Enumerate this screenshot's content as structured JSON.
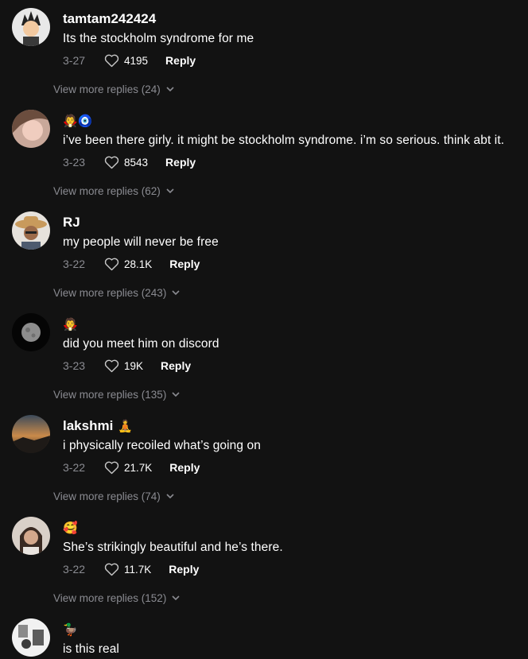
{
  "comments": [
    {
      "author": "tamtam242424",
      "emoji": "",
      "text": "Its the stockholm syndrome for me",
      "date": "3-27",
      "likes": "4195",
      "reply_label": "Reply",
      "more_replies": "View more replies (24)"
    },
    {
      "author": "",
      "emoji": "🧛🧿",
      "text": "i’ve been there girly. it might be stockholm syndrome. i’m so serious. think abt it.",
      "date": "3-23",
      "likes": "8543",
      "reply_label": "Reply",
      "more_replies": "View more replies (62)"
    },
    {
      "author": "RJ",
      "emoji": "",
      "text": "my people will never be free",
      "date": "3-22",
      "likes": "28.1K",
      "reply_label": "Reply",
      "more_replies": "View more replies (243)"
    },
    {
      "author": "",
      "emoji": "🧛",
      "text": "did you meet him on discord",
      "date": "3-23",
      "likes": "19K",
      "reply_label": "Reply",
      "more_replies": "View more replies (135)"
    },
    {
      "author": "lakshmi",
      "emoji": "🧘",
      "text": "i physically recoiled what’s going on",
      "date": "3-22",
      "likes": "21.7K",
      "reply_label": "Reply",
      "more_replies": "View more replies (74)"
    },
    {
      "author": "",
      "emoji": "🥰",
      "text": "She’s strikingly beautiful and he’s there.",
      "date": "3-22",
      "likes": "11.7K",
      "reply_label": "Reply",
      "more_replies": "View more replies (152)"
    },
    {
      "author": "",
      "emoji": "🦆",
      "text": "is this real",
      "date": "",
      "likes": "",
      "reply_label": "",
      "more_replies": ""
    }
  ]
}
